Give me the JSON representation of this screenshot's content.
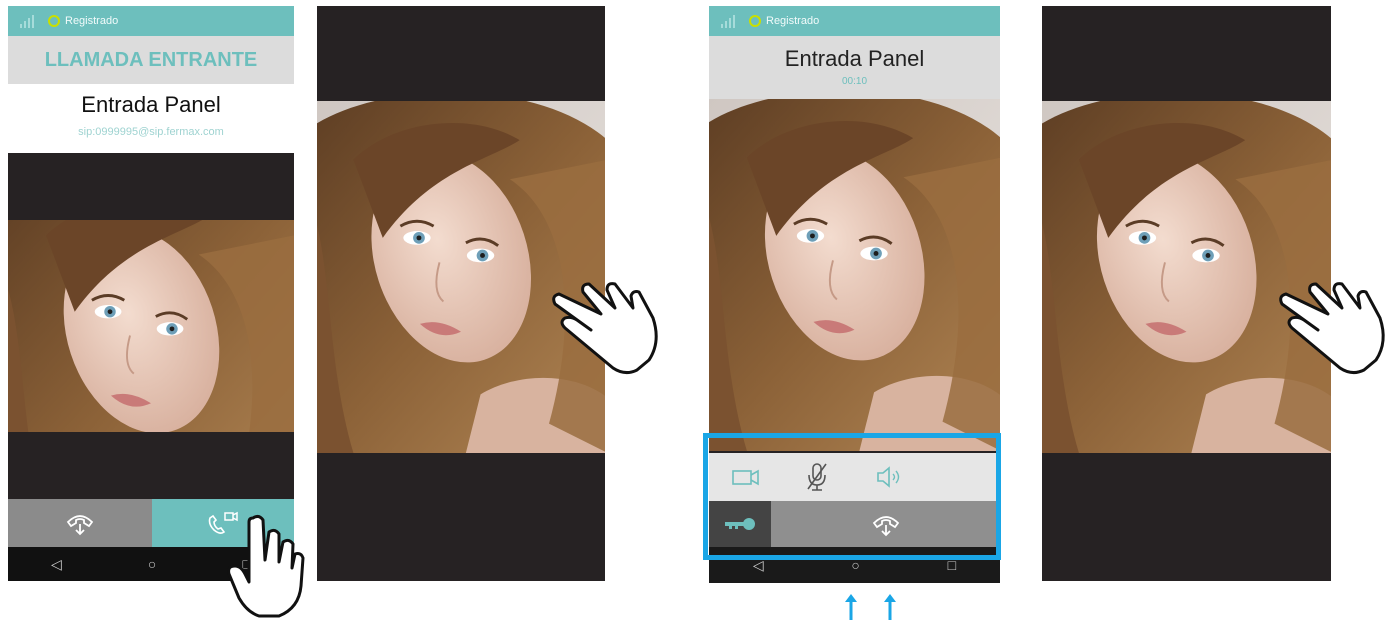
{
  "screen1": {
    "status_text": "Registrado",
    "header_title": "LLAMADA ENTRANTE",
    "caller_name": "Entrada Panel",
    "caller_uri": "sip:0999995@sip.fermax.com",
    "buttons": [
      "hangup-icon",
      "video-call-icon"
    ],
    "nav": [
      "◁",
      "○",
      "□"
    ]
  },
  "screen3": {
    "status_text": "Registrado",
    "caller_name": "Entrada Panel",
    "duration": "00:10",
    "controls": [
      "video-icon",
      "mic-muted-icon",
      "speaker-icon"
    ],
    "actions": [
      "key-icon",
      "hangup-icon"
    ],
    "nav": [
      "◁",
      "○",
      "□"
    ]
  },
  "colors": {
    "accent": "#6dbfbd",
    "highlight_border": "#1aa6e6",
    "dark_bg": "#262223",
    "status_dot": "#c9e000",
    "arrow": "#1aa6e6"
  }
}
